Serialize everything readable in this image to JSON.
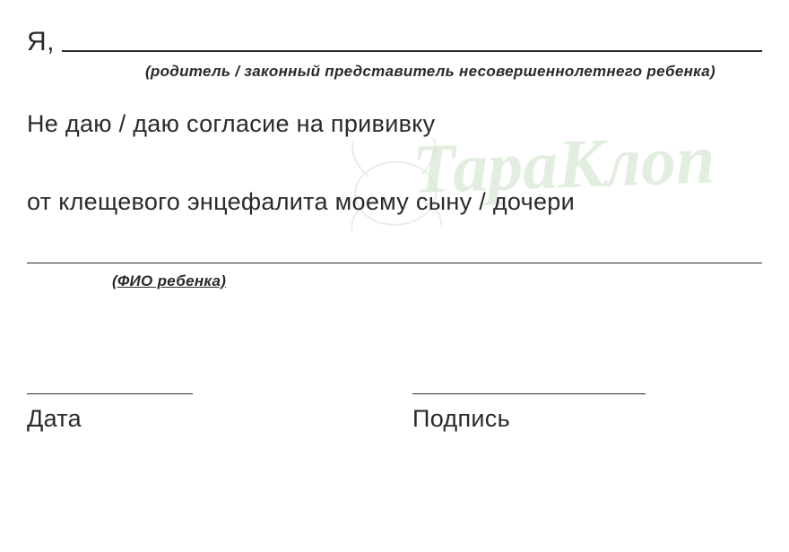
{
  "intro": "Я,",
  "parent_hint": "(родитель / законный представитель несовершеннолетнего ребенка)",
  "body_line1": "Не даю / даю согласие на прививку",
  "body_line2": "от клещевого энцефалита моему сыну / дочери",
  "child_hint": "(ФИО ребенка)",
  "date_label": "Дата",
  "signature_label": "Подпись",
  "watermark_text": "ТараКлоп"
}
